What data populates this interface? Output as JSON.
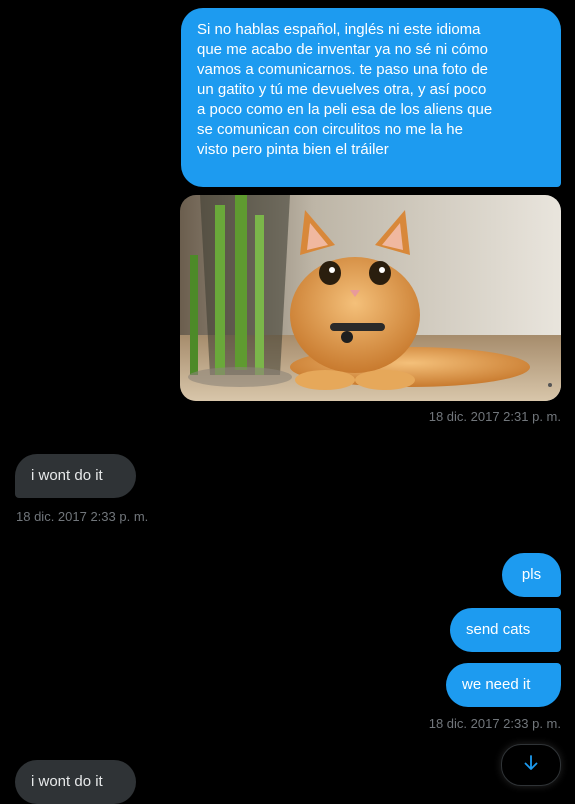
{
  "conversation": {
    "messages": [
      {
        "id": "m1",
        "direction": "sent",
        "text": "Si no hablas español, inglés ni este idioma\nque me acabo de inventar ya no sé ni cómo\nvamos a comunicarnos. te paso una foto de\nun gatito y tú me devuelves otra, y así poco\na poco como en la peli esa de los aliens que\nse comunican con circulitos no me la he\nvisto pero pinta bien el tráiler"
      },
      {
        "id": "m2",
        "direction": "sent",
        "attachment": "photo-orange-kitten",
        "timestamp": "18 dic. 2017 2:31 p. m."
      },
      {
        "id": "m3",
        "direction": "received",
        "text": "i wont do it",
        "timestamp": "18 dic. 2017 2:33 p. m."
      },
      {
        "id": "m4",
        "direction": "sent",
        "text": "pls"
      },
      {
        "id": "m5",
        "direction": "sent",
        "text": "send cats"
      },
      {
        "id": "m6",
        "direction": "sent",
        "text": "we need it",
        "timestamp": "18 dic. 2017 2:33 p. m."
      },
      {
        "id": "m7",
        "direction": "received",
        "text": "i wont do it"
      }
    ]
  },
  "scroll_button": {
    "icon": "arrow-down-icon"
  },
  "colors": {
    "background": "#000000",
    "sent_bubble": "#1d9bf0",
    "received_bubble": "#2f3336",
    "timestamp": "#71767b",
    "accent": "#1d9bf0"
  }
}
